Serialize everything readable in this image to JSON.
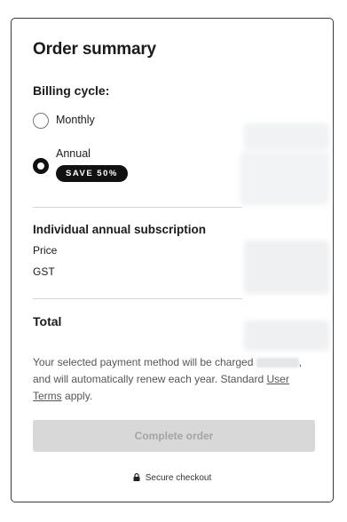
{
  "summary": {
    "title": "Order summary",
    "billing_label": "Billing cycle:",
    "options": [
      {
        "label": "Monthly",
        "selected": false
      },
      {
        "label": "Annual",
        "selected": true
      }
    ],
    "annual_badge": "SAVE 50%"
  },
  "subscription": {
    "title": "Individual annual subscription",
    "price_label": "Price",
    "gst_label": "GST"
  },
  "total_label": "Total",
  "legal": {
    "text_before": "Your selected payment method will be charged",
    "text_after": ", and will automatically renew each year. Standard",
    "link_text": "User Terms",
    "text_end": "apply."
  },
  "cta": {
    "label": "Complete order",
    "enabled": false
  },
  "secure": {
    "label": "Secure checkout",
    "icon": "lock-icon"
  },
  "colors": {
    "badge_bg": "#111111",
    "button_disabled_bg": "#d8d8d8",
    "border": "#3a3a3a"
  }
}
